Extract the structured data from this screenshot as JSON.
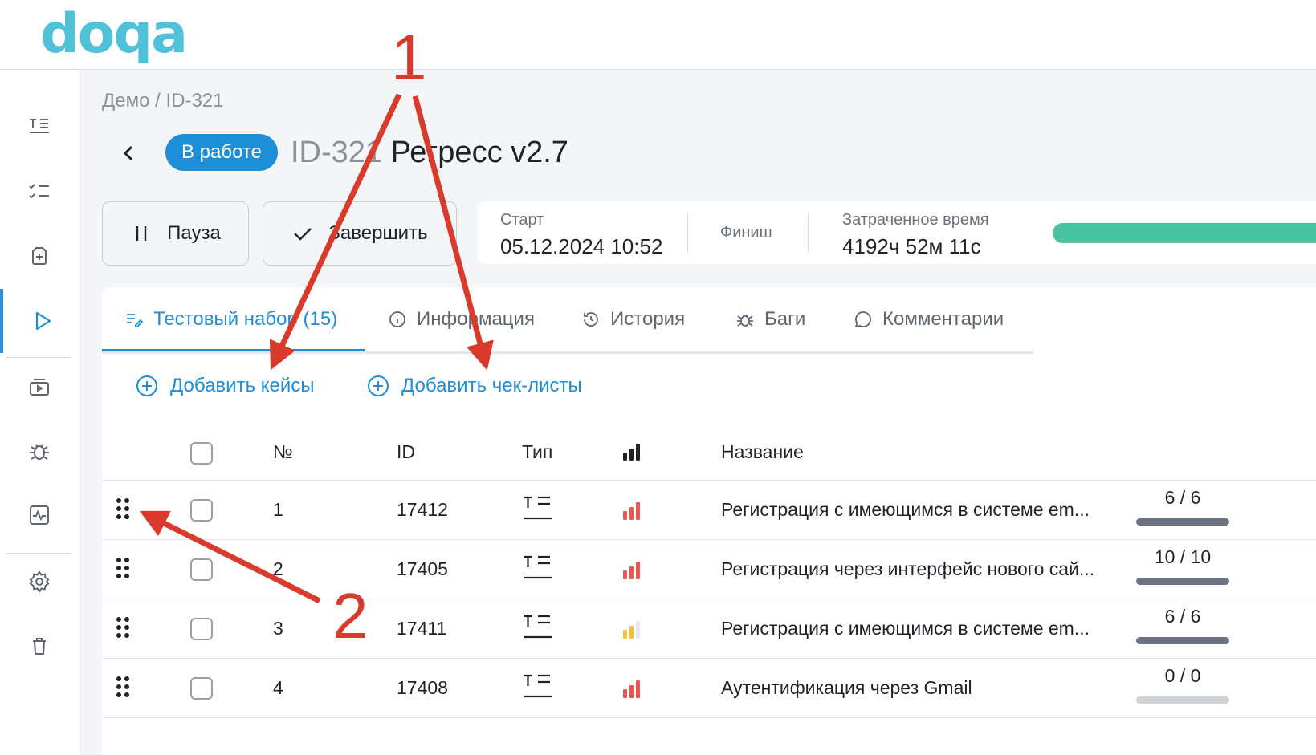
{
  "brand": {
    "logo": "doqa",
    "color": "#4fc1d8"
  },
  "sidebar": {
    "items": [
      {
        "icon": "test-cases-icon",
        "active": false
      },
      {
        "icon": "checklists-icon",
        "active": false
      },
      {
        "icon": "test-plan-icon",
        "active": false
      },
      {
        "icon": "run-play-icon",
        "active": true
      },
      {
        "icon": "launches-icon",
        "active": false
      },
      {
        "icon": "bug-icon",
        "active": false
      },
      {
        "icon": "analytics-icon",
        "active": false
      },
      {
        "icon": "settings-icon",
        "active": false
      },
      {
        "icon": "trash-icon",
        "active": false
      }
    ]
  },
  "breadcrumb": "Демо / ID-321",
  "run": {
    "status": "В работе",
    "id": "ID-321",
    "name": "Регресс v2.7"
  },
  "actions": {
    "pause": "Пауза",
    "finish": "Завершить"
  },
  "timing": {
    "start_label": "Старт",
    "start_value": "05.12.2024 10:52",
    "finish_label": "Финиш",
    "spent_label": "Затраченное время",
    "spent_value": "4192ч 52м 11с"
  },
  "tabs": [
    {
      "label": "Тестовый набор (15)",
      "icon": "test-set-icon",
      "active": true
    },
    {
      "label": "Информация",
      "icon": "info-icon",
      "active": false
    },
    {
      "label": "История",
      "icon": "history-icon",
      "active": false
    },
    {
      "label": "Баги",
      "icon": "bug-icon",
      "active": false
    },
    {
      "label": "Комментарии",
      "icon": "comments-icon",
      "active": false
    }
  ],
  "add_links": {
    "cases": "Добавить кейсы",
    "checklists": "Добавить чек-листы"
  },
  "table": {
    "columns": {
      "num": "№",
      "id": "ID",
      "type": "Тип",
      "priority": "priority-bars-icon",
      "name": "Название"
    },
    "rows": [
      {
        "num": "1",
        "id": "17412",
        "priority": "high",
        "name": "Регистрация с имеющимся в системе em...",
        "count": "6 / 6"
      },
      {
        "num": "2",
        "id": "17405",
        "priority": "high",
        "name": "Регистрация через интерфейс нового сай...",
        "count": "10 / 10"
      },
      {
        "num": "3",
        "id": "17411",
        "priority": "medium",
        "name": "Регистрация с имеющимся в системе em...",
        "count": "6 / 6"
      },
      {
        "num": "4",
        "id": "17408",
        "priority": "high",
        "name": "Аутентификация через Gmail",
        "count": "0 / 0"
      }
    ]
  },
  "annotations": {
    "label_1": "1",
    "label_2": "2",
    "color": "#d93a2b"
  },
  "colors": {
    "accent": "#1d8ed8",
    "progress": "#48c4a1",
    "priority_high": "#f0534f",
    "priority_medium": "#f5c02c"
  }
}
